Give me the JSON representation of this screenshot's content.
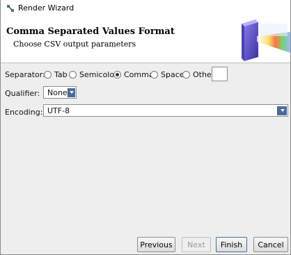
{
  "window": {
    "title": "Render Wizard"
  },
  "header": {
    "title": "Comma Separated Values Format",
    "subtitle": "Choose CSV output parameters"
  },
  "separator": {
    "label": "Separator:",
    "options": [
      {
        "label": "Tab",
        "selected": false
      },
      {
        "label": "Semicolon",
        "selected": false
      },
      {
        "label": "Comma",
        "selected": true
      },
      {
        "label": "Space",
        "selected": false
      },
      {
        "label": "Other",
        "selected": false
      }
    ],
    "other_value": ""
  },
  "qualifier": {
    "label": "Qualifier:",
    "value": "None"
  },
  "encoding": {
    "label": "Encoding:",
    "value": "UTF-8"
  },
  "buttons": {
    "previous": "Previous",
    "next": "Next",
    "finish": "Finish",
    "cancel": "Cancel"
  }
}
